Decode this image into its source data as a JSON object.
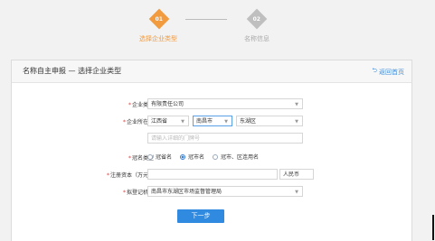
{
  "stepper": {
    "step1": {
      "number": "01",
      "label": "选择企业类型"
    },
    "step2": {
      "number": "02",
      "label": "名称信息"
    }
  },
  "card": {
    "title": "名称自主申报 — 选择企业类型",
    "back_label": "返回首页"
  },
  "form": {
    "enterprise_type": {
      "label": "企业类型",
      "value": "有限责任公司"
    },
    "location": {
      "label": "企业所在地",
      "province": "江西省",
      "city": "南昌市",
      "district": "东湖区",
      "address_placeholder": "请输入详细的门牌号"
    },
    "naming_type": {
      "label": "冠名类型",
      "options": [
        "冠省名",
        "冠市名",
        "冠市、区连用名"
      ],
      "selected": "冠市名"
    },
    "capital": {
      "label": "注册资本（万元）",
      "value": "",
      "unit": "人民币"
    },
    "registration_authority": {
      "label": "拟登记机关",
      "value": "南昌市东湖区市场监督管理局"
    },
    "next_label": "下一步"
  },
  "colors": {
    "active_step": "#f19a3e",
    "inactive_step": "#bfbfbf",
    "primary": "#2f8ae0",
    "required": "#e33333"
  }
}
